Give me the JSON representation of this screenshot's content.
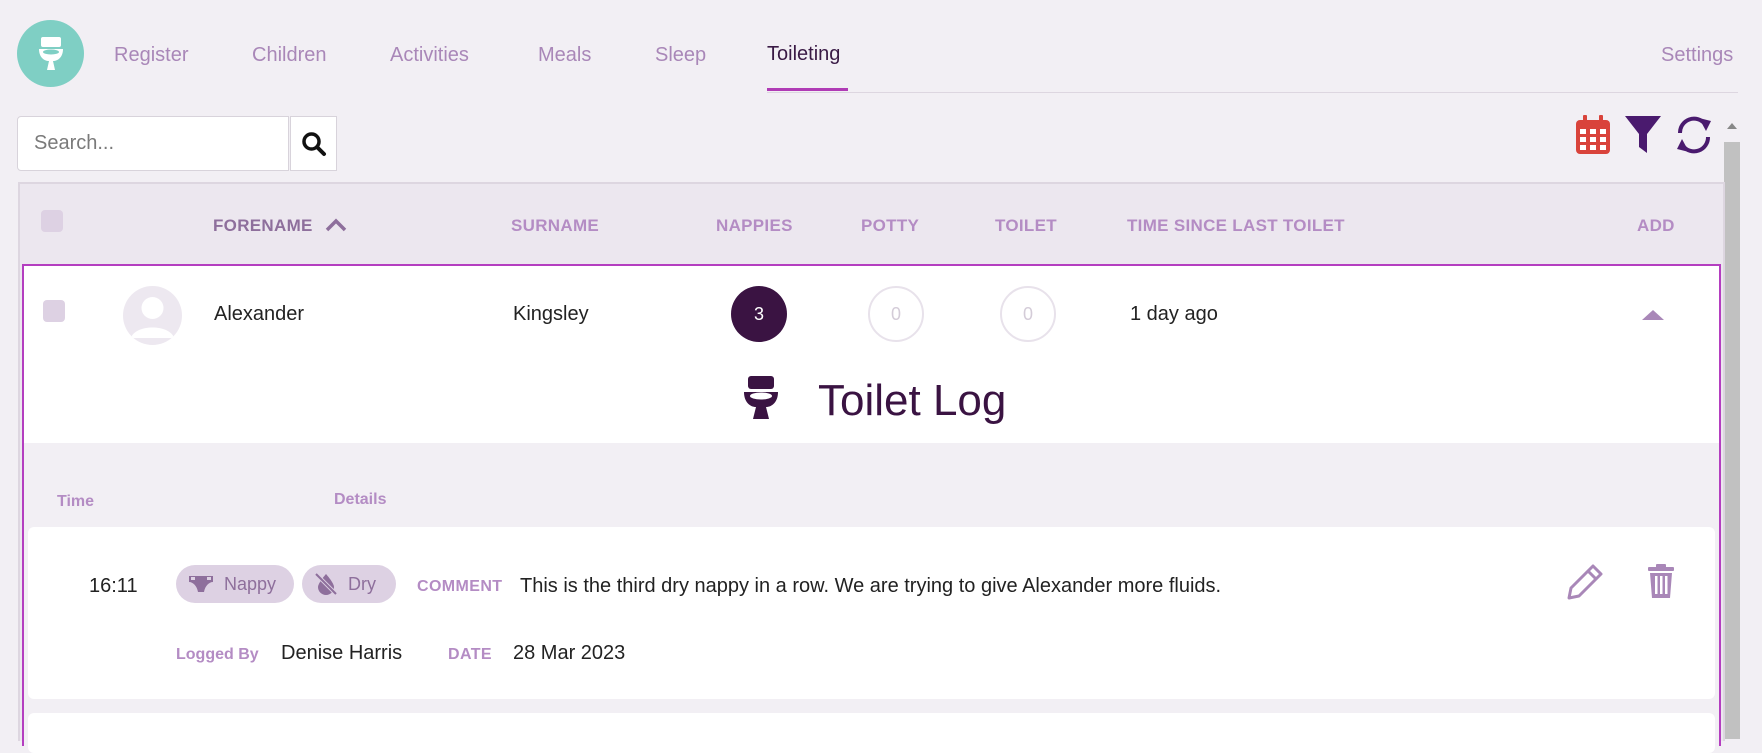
{
  "nav": {
    "tabs": [
      {
        "label": "Register"
      },
      {
        "label": "Children"
      },
      {
        "label": "Activities"
      },
      {
        "label": "Meals"
      },
      {
        "label": "Sleep"
      },
      {
        "label": "Toileting"
      }
    ],
    "active_tab": "Toileting",
    "settings_label": "Settings"
  },
  "search": {
    "placeholder": "Search..."
  },
  "toolbar": {
    "icons": [
      "calendar-icon",
      "filter-icon",
      "refresh-icon"
    ]
  },
  "table": {
    "columns": [
      "FORENAME",
      "SURNAME",
      "NAPPIES",
      "POTTY",
      "TOILET",
      "TIME SINCE LAST TOILET",
      "ADD"
    ],
    "sorted_column": "FORENAME",
    "rows": [
      {
        "forename": "Alexander",
        "surname": "Kingsley",
        "nappies": "3",
        "potty": "0",
        "toilet": "0",
        "time_since": "1 day ago"
      }
    ]
  },
  "toilet_log": {
    "title": "Toilet Log",
    "headers": {
      "time": "Time",
      "details": "Details"
    },
    "entries": [
      {
        "time": "16:11",
        "type": "Nappy",
        "status": "Dry",
        "comment_label": "COMMENT",
        "comment": "This is the third dry nappy in a row. We are trying to give Alexander more fluids.",
        "logged_by_label": "Logged By",
        "logged_by": "Denise Harris",
        "date_label": "DATE",
        "date": "28 Mar 2023"
      }
    ]
  },
  "colors": {
    "accent": "#b03bb5",
    "primary_dark": "#3a1342",
    "label_purple": "#b48cc4",
    "logo_teal": "#7fcfc4",
    "calendar_red": "#d9433b"
  }
}
